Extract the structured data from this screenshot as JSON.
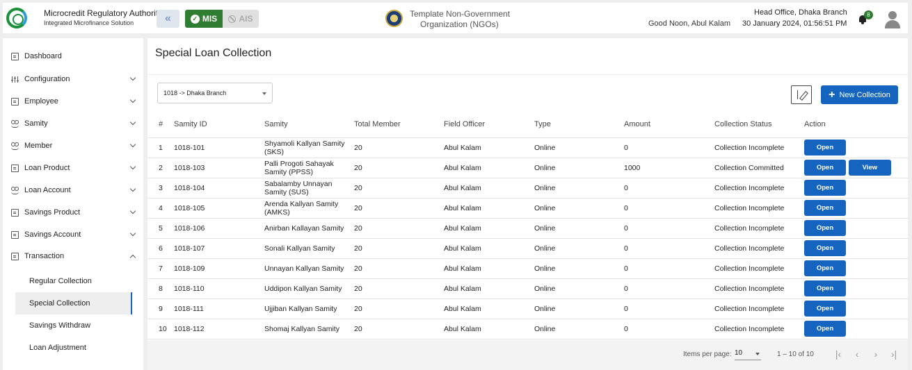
{
  "header": {
    "brand_title": "Microcredit Regulatory Authority",
    "brand_subtitle": "Integrated Microfinance Solution",
    "mode_mis": "MIS",
    "mode_ais": "AIS",
    "org_line1": "Template Non-Government",
    "org_line2": "Organization (NGOs)",
    "greeting": "Good Noon, Abul Kalam",
    "office": "Head Office, Dhaka Branch",
    "datetime": "30 January 2024, 01:56:51 PM",
    "notification_count": "8"
  },
  "sidebar": {
    "dashboard": "Dashboard",
    "items": [
      {
        "label": "Configuration"
      },
      {
        "label": "Employee"
      },
      {
        "label": "Samity"
      },
      {
        "label": "Member"
      },
      {
        "label": "Loan Product"
      },
      {
        "label": "Loan Account"
      },
      {
        "label": "Savings Product"
      },
      {
        "label": "Savings Account"
      },
      {
        "label": "Transaction"
      }
    ],
    "sub_items": [
      {
        "label": "Regular Collection"
      },
      {
        "label": "Special Collection"
      },
      {
        "label": "Savings Withdraw"
      },
      {
        "label": "Loan Adjustment"
      }
    ]
  },
  "main": {
    "title": "Special Loan Collection",
    "branch_select": "1018 -> Dhaka Branch",
    "new_button": "New Collection",
    "columns": [
      "#",
      "Samity ID",
      "Samity",
      "Total Member",
      "Field Officer",
      "Type",
      "Amount",
      "Collection Status",
      "Action"
    ],
    "rows": [
      {
        "num": "1",
        "id": "1018-101",
        "samity": "Shyamoli Kallyan Samity (SKS)",
        "total": "20",
        "officer": "Abul Kalam",
        "type": "Online",
        "amount": "0",
        "status": "Collection Incomplete"
      },
      {
        "num": "2",
        "id": "1018-103",
        "samity": "Palli Progoti Sahayak Samity (PPSS)",
        "total": "20",
        "officer": "Abul Kalam",
        "type": "Online",
        "amount": "1000",
        "status": "Collection Committed"
      },
      {
        "num": "3",
        "id": "1018-104",
        "samity": "Sabalamby Unnayan Samity (SUS)",
        "total": "20",
        "officer": "Abul Kalam",
        "type": "Online",
        "amount": "0",
        "status": "Collection Incomplete"
      },
      {
        "num": "4",
        "id": "1018-105",
        "samity": "Arenda Kallyan Samity (AMKS)",
        "total": "20",
        "officer": "Abul Kalam",
        "type": "Online",
        "amount": "0",
        "status": "Collection Incomplete"
      },
      {
        "num": "5",
        "id": "1018-106",
        "samity": "Anirban Kallayan Samity",
        "total": "20",
        "officer": "Abul Kalam",
        "type": "Online",
        "amount": "0",
        "status": "Collection Incomplete"
      },
      {
        "num": "6",
        "id": "1018-107",
        "samity": "Sonali Kallyan Samity",
        "total": "20",
        "officer": "Abul Kalam",
        "type": "Online",
        "amount": "0",
        "status": "Collection Incomplete"
      },
      {
        "num": "7",
        "id": "1018-109",
        "samity": "Unnayan Kallyan Samity",
        "total": "20",
        "officer": "Abul Kalam",
        "type": "Online",
        "amount": "0",
        "status": "Collection Incomplete"
      },
      {
        "num": "8",
        "id": "1018-110",
        "samity": "Uddipon Kallyan Samity",
        "total": "20",
        "officer": "Abul Kalam",
        "type": "Online",
        "amount": "0",
        "status": "Collection Incomplete"
      },
      {
        "num": "9",
        "id": "1018-111",
        "samity": "Ujjiban Kallyan Samity",
        "total": "20",
        "officer": "Abul Kalam",
        "type": "Online",
        "amount": "0",
        "status": "Collection Incomplete"
      },
      {
        "num": "10",
        "id": "1018-112",
        "samity": "Shomaj Kallyan Samity",
        "total": "20",
        "officer": "Abul Kalam",
        "type": "Online",
        "amount": "0",
        "status": "Collection Incomplete"
      }
    ],
    "open_label": "Open",
    "view_label": "View"
  },
  "paginator": {
    "items_per_page_label": "Items per page:",
    "page_size": "10",
    "range": "1 – 10 of 10"
  },
  "colors": {
    "primary": "#1565c0",
    "mis_green": "#2e7d32"
  }
}
